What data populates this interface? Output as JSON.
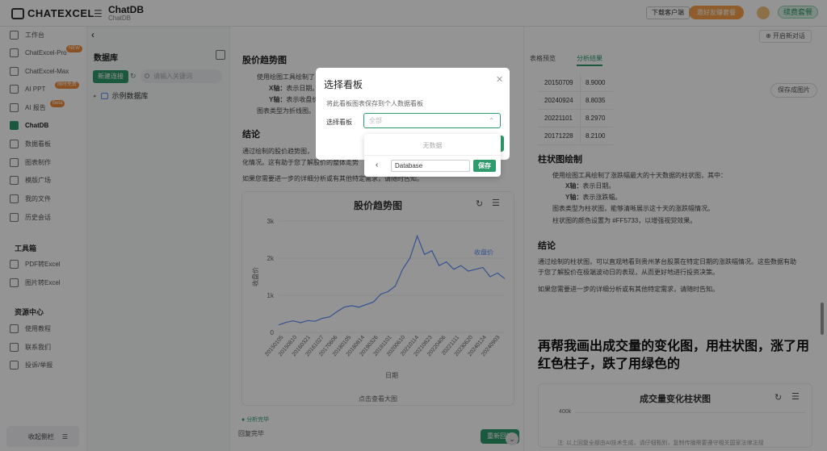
{
  "app": {
    "logo_text": "CHATEXCEL",
    "title": "ChatDB",
    "subtitle": "ChatDB",
    "download_client": "下载客户端",
    "orange_btn": "邀好友赚套餐",
    "renew_btn": "续费套餐"
  },
  "sidebar": {
    "items": [
      {
        "label": "工作台"
      },
      {
        "label": "ChatExcel-Pro",
        "badge": "NEW"
      },
      {
        "label": "ChatExcel-Max"
      },
      {
        "label": "AI PPT",
        "badge": "限时免费"
      },
      {
        "label": "AI 报告",
        "badge": "Beta"
      },
      {
        "label": "ChatDB"
      },
      {
        "label": "数据看板"
      },
      {
        "label": "图表制作"
      },
      {
        "label": "模版广场"
      },
      {
        "label": "我的文件"
      },
      {
        "label": "历史会话"
      }
    ],
    "tools_title": "工具箱",
    "tools": [
      {
        "label": "PDF转Excel"
      },
      {
        "label": "图片转Excel"
      }
    ],
    "resources_title": "资源中心",
    "resources": [
      {
        "label": "使用教程"
      },
      {
        "label": "联系我们"
      },
      {
        "label": "投诉/举报"
      }
    ],
    "collapse_label": "收起侧栏"
  },
  "db_panel": {
    "title": "数据库",
    "new_connection": "新建连接",
    "search_placeholder": "请输入关键词",
    "tree_item": "示例数据库"
  },
  "main": {
    "section1_title": "股价趋势图",
    "para1_line1": "使用绘图工具绘制了",
    "para1_line2_label": "X轴：",
    "para1_line2": "表示日期。",
    "para1_line3_label": "Y轴：",
    "para1_line3": "表示收盘价",
    "para1_line4": "图表类型为折线图。",
    "section2_title": "结论",
    "concl_line1": "通过绘制的股价趋势图，",
    "concl_line2": "化情况。这有助于您了解股价的整体走势",
    "concl_line3": "如果您需要进一步的详细分析或有其他特定需求，请随时告知。",
    "click_view": "点击查看大图",
    "analysis_done": "分析完毕",
    "reply_done": "回复完毕",
    "new_chat_bottom": "重新回答"
  },
  "chart_data": {
    "type": "line",
    "title": "股价趋势图",
    "xlabel": "日期",
    "ylabel": "收盘价",
    "ylim": [
      0,
      3000
    ],
    "yticks": [
      "0",
      "1k",
      "2k",
      "3k"
    ],
    "xticks": [
      "20150105",
      "20150810",
      "20160321",
      "20161027",
      "20170606",
      "20180105",
      "20180814",
      "20190326",
      "20191101",
      "20200610",
      "20210114",
      "20210823",
      "20220406",
      "20221111",
      "20230620",
      "20240124",
      "20240903"
    ],
    "series": [
      {
        "name": "收盘价",
        "color": "#5b8ff9"
      }
    ],
    "values": [
      200,
      270,
      310,
      260,
      320,
      300,
      380,
      420,
      560,
      680,
      720,
      680,
      750,
      820,
      1030,
      1100,
      1250,
      1700,
      2000,
      2600,
      2100,
      2200,
      1800,
      1900,
      1700,
      1800,
      1650,
      1700,
      1750,
      1500,
      1600,
      1450
    ],
    "annotation": "收盘价"
  },
  "right": {
    "new_chat": "开启新对话",
    "tab1": "表格预览",
    "tab2": "分析结果",
    "table": [
      [
        "20150709",
        "8.9000"
      ],
      [
        "20240924",
        "8.8035"
      ],
      [
        "20221101",
        "8.2970"
      ],
      [
        "20171228",
        "8.2100"
      ]
    ],
    "save_image": "保存成图片",
    "section_bar_title": "柱状图绘制",
    "bar_line1": "使用绘图工具绘制了涨跌幅最大的十天数据的柱状图，其中：",
    "bar_x_label": "X轴：",
    "bar_x": "表示日期。",
    "bar_y_label": "Y轴：",
    "bar_y": "表示涨跌幅。",
    "bar_line4": "图表类型为柱状图，能够清晰展示这十天的涨跌幅情况。",
    "bar_line5": "柱状图的颜色设置为 #FF5733，以增强视觉效果。",
    "section_concl": "结论",
    "concl_line1": "通过绘制的柱状图，可以直观地看到贵州茅台股票在特定日期的涨跌幅情况。这些数据有助",
    "concl_line2": "于您了解股价在极端波动日的表现，从而更好地进行投资决策。",
    "concl_line3": "如果您需要进一步的详细分析或有其他特定需求，请随时告知。",
    "big_question": "再帮我画出成交量的变化图，用柱状图，涨了用红色柱子，跌了用绿色的",
    "card_title": "成交量变化柱状图",
    "card_ytick": "400k",
    "footer_note": "注: 以上回复全部由AI技术生成，请仔细甄别，复制传播需要遵守相关国家法律法规"
  },
  "modal": {
    "title": "选择看板",
    "desc": "将此看板图表保存到个人数据看板",
    "label": "选择看板",
    "select_placeholder": "全部",
    "empty": "无数据",
    "input_value": "Database",
    "save": "保存"
  }
}
